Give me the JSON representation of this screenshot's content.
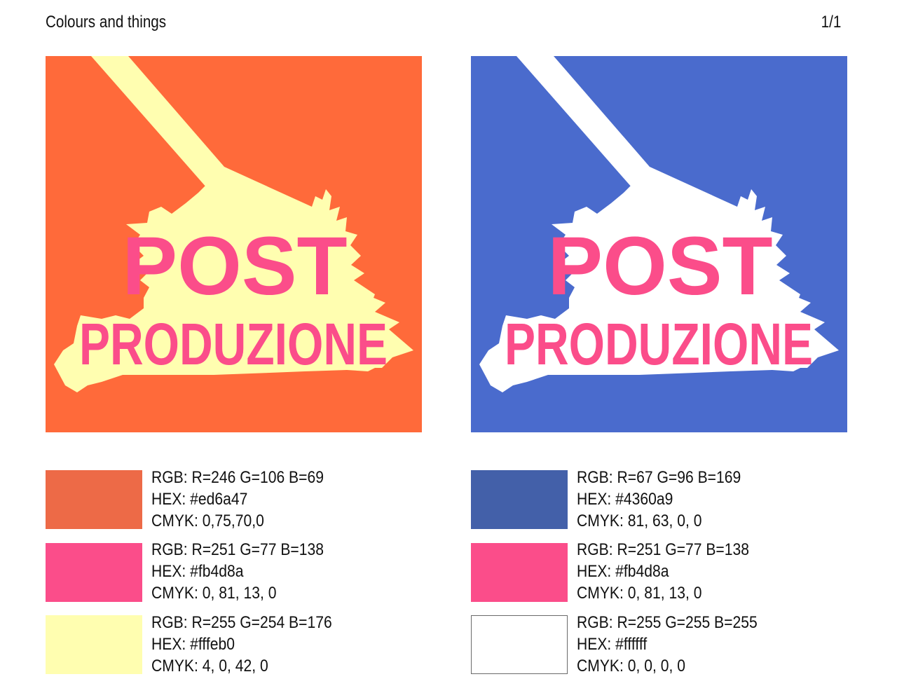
{
  "header": {
    "title": "Colours and things",
    "page": "1/1"
  },
  "logos": [
    {
      "line1": "POST",
      "line2": "PRODUZIONE",
      "background": "#ff6a3a",
      "splash": "#fffeb0",
      "text_color": "#fb4d8a"
    },
    {
      "line1": "POST",
      "line2": "PRODUZIONE",
      "background": "#4a6bcd",
      "splash": "#ffffff",
      "text_color": "#fb4d8a"
    }
  ],
  "palettes": {
    "left": [
      {
        "color": "#ed6a47",
        "rgb": "RGB: R=246 G=106 B=69",
        "hex": "HEX: #ed6a47",
        "cmyk": "CMYK: 0,75,70,0"
      },
      {
        "color": "#fb4d8a",
        "rgb": "RGB: R=251 G=77 B=138",
        "hex": "HEX: #fb4d8a",
        "cmyk": "CMYK: 0, 81, 13, 0"
      },
      {
        "color": "#fffeb0",
        "rgb": "RGB: R=255 G=254 B=176",
        "hex": "HEX: #fffeb0",
        "cmyk": "CMYK: 4, 0, 42, 0"
      }
    ],
    "right": [
      {
        "color": "#4360a9",
        "rgb": "RGB: R=67 G=96 B=169",
        "hex": "HEX: #4360a9",
        "cmyk": "CMYK: 81, 63, 0, 0"
      },
      {
        "color": "#fb4d8a",
        "rgb": "RGB: R=251 G=77 B=138",
        "hex": "HEX: #fb4d8a",
        "cmyk": "CMYK: 0, 81, 13, 0"
      },
      {
        "color": "#ffffff",
        "rgb": "RGB: R=255 G=255 B=255",
        "hex": "HEX: #ffffff",
        "cmyk": "CMYK: 0, 0, 0, 0"
      }
    ]
  }
}
